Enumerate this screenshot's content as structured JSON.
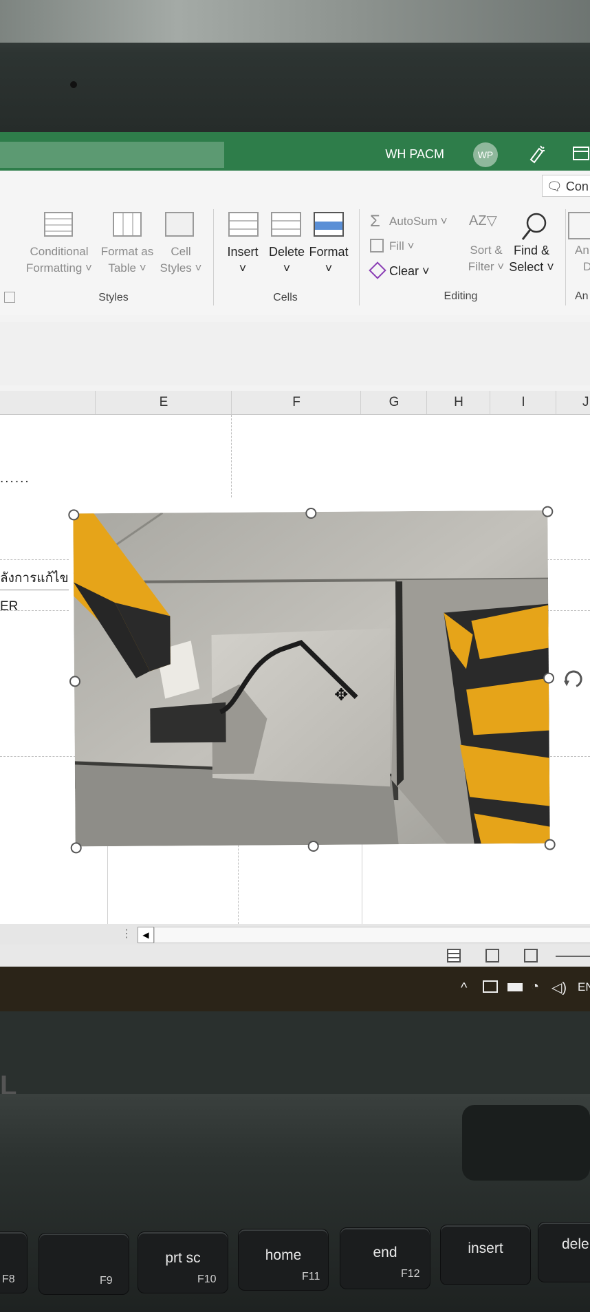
{
  "titlebar": {
    "account_name": "WH PACM",
    "avatar_initials": "WP",
    "accent_color": "#2e7d4a"
  },
  "ribbon": {
    "comments_label": "Con",
    "styles_group": {
      "label": "Styles",
      "conditional_formatting": [
        "Conditional",
        "Formatting ˅"
      ],
      "format_as_table": [
        "Format as",
        "Table ˅"
      ],
      "cell_styles": [
        "Cell",
        "Styles ˅"
      ]
    },
    "cells_group": {
      "label": "Cells",
      "insert": "Insert",
      "delete": "Delete",
      "format": "Format",
      "chevron": "˅"
    },
    "editing_group": {
      "label": "Editing",
      "autosum": "AutoSum ˅",
      "fill": "Fill ˅",
      "clear": "Clear ˅",
      "sort_filter": [
        "Sort &",
        "Filter ˅"
      ],
      "find_select": [
        "Find &",
        "Select ˅"
      ]
    },
    "analysis_group": {
      "label": "An",
      "button": [
        "An",
        "D"
      ]
    }
  },
  "sheet": {
    "columns": [
      "E",
      "F",
      "G",
      "H",
      "I",
      "J"
    ],
    "cells": {
      "dots": "......",
      "thai_text": "ลังการแก้ไข",
      "er_text": "ER"
    }
  },
  "picture": {
    "description_icon": "rotate-handle-icon",
    "colors": {
      "concrete": "#b8b6b0",
      "stripe_yellow": "#e6a419",
      "stripe_black": "#2a2a2a"
    }
  },
  "taskbar": {
    "tray_icons": [
      "chevron-up-icon",
      "meet-now-icon",
      "battery-icon",
      "wifi-icon",
      "speaker-icon"
    ],
    "language": "EN"
  },
  "keyboard": {
    "keys": [
      {
        "label": "",
        "fn": "F8"
      },
      {
        "label": "",
        "fn": "F9"
      },
      {
        "label": "prt sc",
        "fn": "F10"
      },
      {
        "label": "home",
        "fn": "F11"
      },
      {
        "label": "end",
        "fn": "F12"
      },
      {
        "label": "insert",
        "fn": ""
      },
      {
        "label": "dele",
        "fn": ""
      }
    ]
  }
}
